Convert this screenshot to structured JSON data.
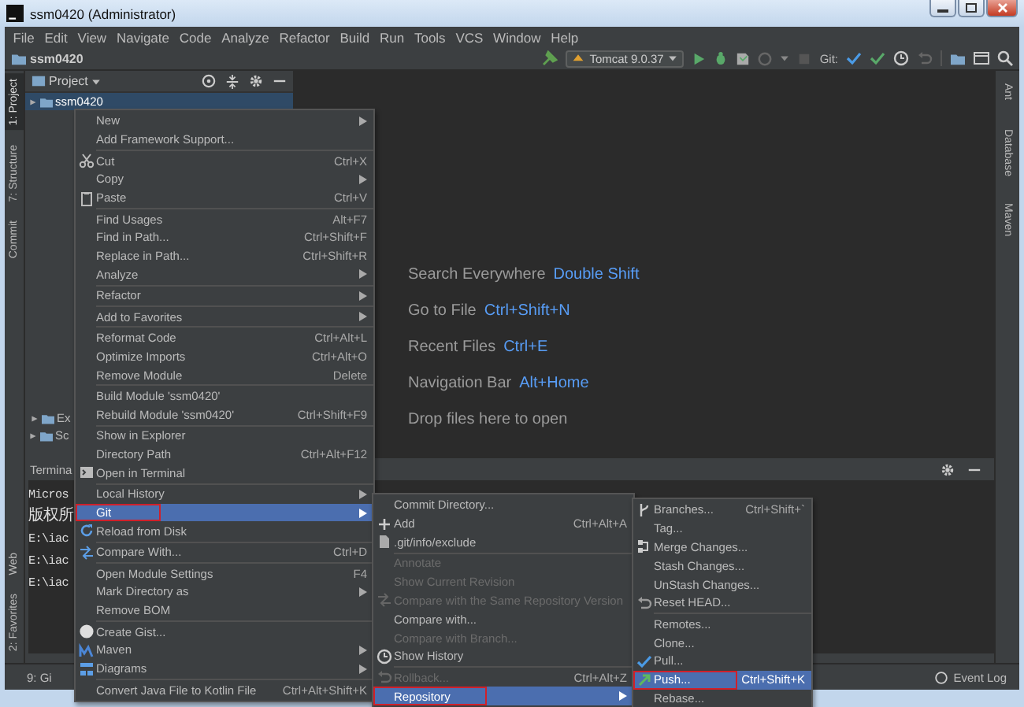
{
  "title_bar": {
    "title": "ssm0420 (Administrator)"
  },
  "menu_bar": [
    "File",
    "Edit",
    "View",
    "Navigate",
    "Code",
    "Analyze",
    "Refactor",
    "Build",
    "Run",
    "Tools",
    "VCS",
    "Window",
    "Help"
  ],
  "nav_bar": {
    "project": "ssm0420",
    "run_config": "Tomcat 9.0.37",
    "git_label": "Git:"
  },
  "left_strip": {
    "top": [
      {
        "label": "1: Project",
        "selected": true
      },
      {
        "label": "7: Structure",
        "selected": false
      },
      {
        "label": "Commit",
        "selected": false
      }
    ],
    "bottom": [
      {
        "label": "Web",
        "selected": false
      },
      {
        "label": "2: Favorites",
        "selected": false
      }
    ]
  },
  "project_panel": {
    "title": "Project",
    "tree": [
      {
        "label": "ssm0420",
        "selected": true
      },
      {
        "label": "Ex",
        "selected": false
      },
      {
        "label": "Sc",
        "selected": false
      }
    ]
  },
  "editor_hints": [
    {
      "text": "Search Everywhere",
      "shortcut": "Double Shift"
    },
    {
      "text": "Go to File",
      "shortcut": "Ctrl+Shift+N"
    },
    {
      "text": "Recent Files",
      "shortcut": "Ctrl+E"
    },
    {
      "text": "Navigation Bar",
      "shortcut": "Alt+Home"
    },
    {
      "text": "Drop files here to open"
    }
  ],
  "right_strip": [
    "Ant",
    "Database",
    "Maven"
  ],
  "terminal": {
    "title": "Termina",
    "lines": [
      "Micros",
      "版权所",
      "E:\\iac",
      "E:\\iac",
      "E:\\iac"
    ]
  },
  "status_bar": {
    "left": "9: Gi",
    "right": "Event Log"
  },
  "context_menu": {
    "items": [
      {
        "kind": "item",
        "label": "New",
        "submenu": true,
        "selected": false,
        "outlined": false
      },
      {
        "kind": "item",
        "label": "Add Framework Support...",
        "selected": false,
        "outlined": false
      },
      {
        "kind": "separator"
      },
      {
        "kind": "item",
        "label": "Cut",
        "shortcut": "Ctrl+X",
        "selected": false,
        "outlined": false
      },
      {
        "kind": "item",
        "label": "Copy",
        "submenu": true,
        "selected": false,
        "outlined": false
      },
      {
        "kind": "item",
        "label": "Paste",
        "shortcut": "Ctrl+V",
        "selected": false,
        "outlined": false
      },
      {
        "kind": "separator"
      },
      {
        "kind": "item",
        "label": "Find Usages",
        "shortcut": "Alt+F7",
        "selected": false,
        "outlined": false
      },
      {
        "kind": "item",
        "label": "Find in Path...",
        "shortcut": "Ctrl+Shift+F",
        "selected": false,
        "outlined": false
      },
      {
        "kind": "item",
        "label": "Replace in Path...",
        "shortcut": "Ctrl+Shift+R",
        "selected": false,
        "outlined": false
      },
      {
        "kind": "item",
        "label": "Analyze",
        "submenu": true,
        "selected": false,
        "outlined": false
      },
      {
        "kind": "separator"
      },
      {
        "kind": "item",
        "label": "Refactor",
        "submenu": true,
        "selected": false,
        "outlined": false
      },
      {
        "kind": "separator"
      },
      {
        "kind": "item",
        "label": "Add to Favorites",
        "submenu": true,
        "selected": false,
        "outlined": false
      },
      {
        "kind": "separator"
      },
      {
        "kind": "item",
        "label": "Reformat Code",
        "shortcut": "Ctrl+Alt+L",
        "selected": false,
        "outlined": false
      },
      {
        "kind": "item",
        "label": "Optimize Imports",
        "shortcut": "Ctrl+Alt+O",
        "selected": false,
        "outlined": false
      },
      {
        "kind": "item",
        "label": "Remove Module",
        "shortcut": "Delete",
        "selected": false,
        "outlined": false
      },
      {
        "kind": "separator"
      },
      {
        "kind": "item",
        "label": "Build Module 'ssm0420'",
        "selected": false,
        "outlined": false
      },
      {
        "kind": "item",
        "label": "Rebuild Module 'ssm0420'",
        "shortcut": "Ctrl+Shift+F9",
        "selected": false,
        "outlined": false
      },
      {
        "kind": "separator"
      },
      {
        "kind": "item",
        "label": "Show in Explorer",
        "selected": false,
        "outlined": false
      },
      {
        "kind": "item",
        "label": "Directory Path",
        "shortcut": "Ctrl+Alt+F12",
        "selected": false,
        "outlined": false
      },
      {
        "kind": "item",
        "label": "Open in Terminal",
        "selected": false,
        "outlined": false
      },
      {
        "kind": "separator"
      },
      {
        "kind": "item",
        "label": "Local History",
        "submenu": true,
        "selected": false,
        "outlined": false
      },
      {
        "kind": "item",
        "label": "Git",
        "submenu": true,
        "selected": true,
        "outlined": true
      },
      {
        "kind": "item",
        "label": "Reload from Disk",
        "selected": false,
        "outlined": false
      },
      {
        "kind": "separator"
      },
      {
        "kind": "item",
        "label": "Compare With...",
        "shortcut": "Ctrl+D",
        "selected": false,
        "outlined": false
      },
      {
        "kind": "separator"
      },
      {
        "kind": "item",
        "label": "Open Module Settings",
        "shortcut": "F4",
        "selected": false,
        "outlined": false
      },
      {
        "kind": "item",
        "label": "Mark Directory as",
        "submenu": true,
        "selected": false,
        "outlined": false
      },
      {
        "kind": "item",
        "label": "Remove BOM",
        "selected": false,
        "outlined": false
      },
      {
        "kind": "separator"
      },
      {
        "kind": "item",
        "label": "Create Gist...",
        "selected": false,
        "outlined": false
      },
      {
        "kind": "item",
        "label": "Maven",
        "submenu": true,
        "selected": false,
        "outlined": false
      },
      {
        "kind": "item",
        "label": "Diagrams",
        "submenu": true,
        "selected": false,
        "outlined": false
      },
      {
        "kind": "separator"
      },
      {
        "kind": "item",
        "label": "Convert Java File to Kotlin File",
        "shortcut": "Ctrl+Alt+Shift+K",
        "selected": false,
        "outlined": false
      }
    ]
  },
  "git_menu": {
    "items": [
      {
        "kind": "item",
        "label": "Commit Directory...",
        "selected": false,
        "disabled": false,
        "outlined": false
      },
      {
        "kind": "item",
        "label": "Add",
        "shortcut": "Ctrl+Alt+A",
        "selected": false,
        "disabled": false,
        "outlined": false
      },
      {
        "kind": "item",
        "label": ".git/info/exclude",
        "selected": false,
        "disabled": false,
        "outlined": false
      },
      {
        "kind": "separator"
      },
      {
        "kind": "item",
        "label": "Annotate",
        "selected": false,
        "disabled": true,
        "outlined": false
      },
      {
        "kind": "item",
        "label": "Show Current Revision",
        "selected": false,
        "disabled": true,
        "outlined": false
      },
      {
        "kind": "item",
        "label": "Compare with the Same Repository Version",
        "selected": false,
        "disabled": true,
        "outlined": false
      },
      {
        "kind": "item",
        "label": "Compare with...",
        "selected": false,
        "disabled": false,
        "outlined": false
      },
      {
        "kind": "item",
        "label": "Compare with Branch...",
        "selected": false,
        "disabled": true,
        "outlined": false
      },
      {
        "kind": "item",
        "label": "Show History",
        "selected": false,
        "disabled": false,
        "outlined": false
      },
      {
        "kind": "separator"
      },
      {
        "kind": "item",
        "label": "Rollback...",
        "shortcut": "Ctrl+Alt+Z",
        "selected": false,
        "disabled": true,
        "outlined": false
      },
      {
        "kind": "item",
        "label": "Repository",
        "submenu": true,
        "selected": true,
        "disabled": false,
        "outlined": true
      }
    ]
  },
  "repository_menu": {
    "items": [
      {
        "kind": "item",
        "label": "Branches...",
        "shortcut": "Ctrl+Shift+`",
        "selected": false,
        "outlined": false
      },
      {
        "kind": "item",
        "label": "Tag...",
        "selected": false,
        "outlined": false
      },
      {
        "kind": "item",
        "label": "Merge Changes...",
        "selected": false,
        "outlined": false
      },
      {
        "kind": "item",
        "label": "Stash Changes...",
        "selected": false,
        "outlined": false
      },
      {
        "kind": "item",
        "label": "UnStash Changes...",
        "selected": false,
        "outlined": false
      },
      {
        "kind": "item",
        "label": "Reset HEAD...",
        "selected": false,
        "outlined": false
      },
      {
        "kind": "separator"
      },
      {
        "kind": "item",
        "label": "Remotes...",
        "selected": false,
        "outlined": false
      },
      {
        "kind": "item",
        "label": "Clone...",
        "selected": false,
        "outlined": false
      },
      {
        "kind": "item",
        "label": "Pull...",
        "selected": false,
        "outlined": false
      },
      {
        "kind": "item",
        "label": "Push...",
        "shortcut": "Ctrl+Shift+K",
        "selected": true,
        "outlined": true
      },
      {
        "kind": "item",
        "label": "Rebase...",
        "selected": false,
        "outlined": false
      }
    ]
  }
}
